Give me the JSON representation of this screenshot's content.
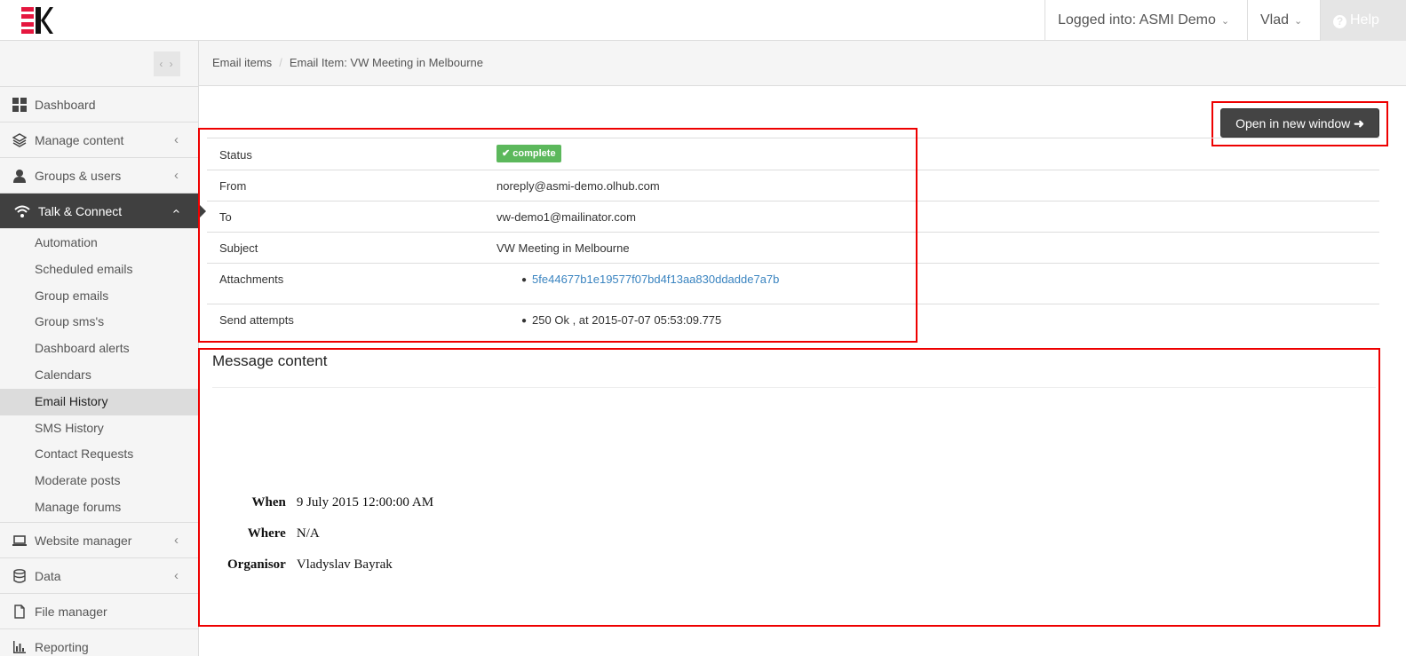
{
  "header": {
    "logged_into": "Logged into: ASMI Demo",
    "user": "Vlad",
    "help": "Help"
  },
  "sidebar": {
    "items": [
      {
        "label": "Dashboard",
        "icon": "dashboard-grid-icon"
      },
      {
        "label": "Manage content",
        "icon": "layers-icon"
      },
      {
        "label": "Groups & users",
        "icon": "user-icon"
      },
      {
        "label": "Talk & Connect",
        "icon": "wifi-icon"
      },
      {
        "label": "Website manager",
        "icon": "laptop-icon"
      },
      {
        "label": "Data",
        "icon": "database-icon"
      },
      {
        "label": "File manager",
        "icon": "file-icon"
      },
      {
        "label": "Reporting",
        "icon": "bar-chart-icon"
      }
    ],
    "subitems": [
      "Automation",
      "Scheduled emails",
      "Group emails",
      "Group sms's",
      "Dashboard alerts",
      "Calendars",
      "Email History",
      "SMS History",
      "Contact Requests",
      "Moderate posts",
      "Manage forums"
    ]
  },
  "breadcrumb": {
    "items": [
      "Email items",
      "Email Item: VW Meeting in Melbourne"
    ]
  },
  "actions": {
    "open_new_window": "Open in new window"
  },
  "details": {
    "status_label": "Status",
    "status_value": "complete",
    "from_label": "From",
    "from_value": "noreply@asmi-demo.olhub.com",
    "to_label": "To",
    "to_value": "vw-demo1@mailinator.com",
    "subject_label": "Subject",
    "subject_value": "VW Meeting in Melbourne",
    "attachments_label": "Attachments",
    "attachment_value": "5fe44677b1e19577f07bd4f13aa830ddadde7a7b",
    "attempts_label": "Send attempts",
    "attempt_value": "250 Ok , at 2015-07-07 05:53:09.775"
  },
  "message": {
    "title": "Message content",
    "when_label": "When",
    "when_value": "9 July 2015 12:00:00 AM",
    "where_label": "Where",
    "where_value": "N/A",
    "organisor_label": "Organisor",
    "organisor_value": "Vladyslav Bayrak"
  },
  "colors": {
    "accent_red": "#e5173f",
    "status_green": "#5cb85c",
    "active_nav": "#404040",
    "highlight_box": "#ee0000"
  }
}
